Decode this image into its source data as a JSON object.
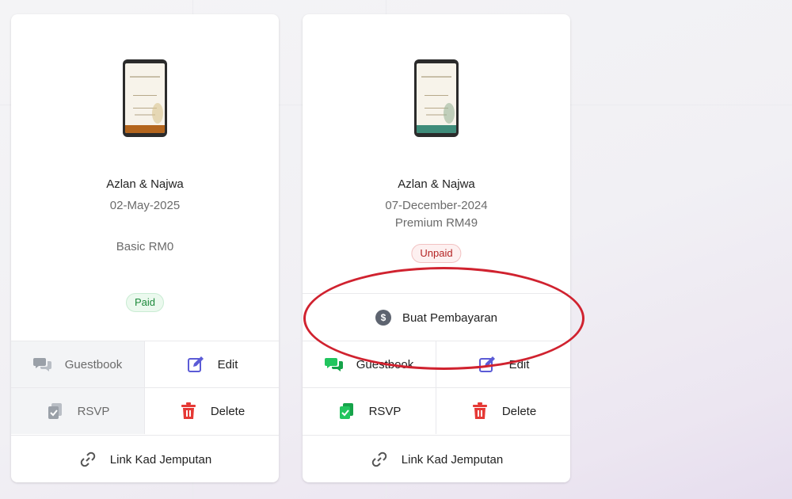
{
  "cards": [
    {
      "name": "Azlan & Najwa",
      "date": "02-May-2025",
      "plan": "Basic RM0",
      "status": "Paid",
      "actions": {
        "guestbook": "Guestbook",
        "edit": "Edit",
        "rsvp": "RSVP",
        "delete": "Delete",
        "link": "Link Kad Jemputan"
      }
    },
    {
      "name": "Azlan & Najwa",
      "date": "07-December-2024",
      "plan": "Premium RM49",
      "status": "Unpaid",
      "pay_label": "Buat Pembayaran",
      "actions": {
        "guestbook": "Guestbook",
        "edit": "Edit",
        "rsvp": "RSVP",
        "delete": "Delete",
        "link": "Link Kad Jemputan"
      }
    }
  ],
  "icons": {
    "guestbook": "chat-bubbles-icon",
    "edit": "pencil-square-icon",
    "rsvp": "clipboard-check-icon",
    "delete": "trash-icon",
    "link": "link-icon",
    "pay": "dollar-circle-icon"
  },
  "colors": {
    "paid": "#1d8a3b",
    "unpaid": "#b42323",
    "guestbook_active": "#22c55e",
    "edit": "#5b5bd6",
    "delete": "#e53935",
    "annotation": "#d0222f"
  }
}
